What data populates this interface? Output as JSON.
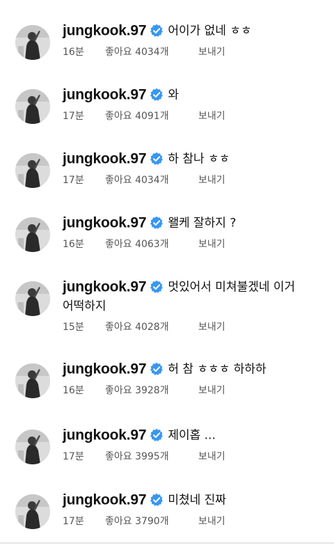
{
  "comments": [
    {
      "username": "jungkook.97",
      "text": "어이가 없네 ㅎㅎ",
      "time": "16분",
      "likes": "좋아요 4034개",
      "reply": "보내기"
    },
    {
      "username": "jungkook.97",
      "text": "와",
      "time": "17분",
      "likes": "좋아요 4091개",
      "reply": "보내기"
    },
    {
      "username": "jungkook.97",
      "text": "하 참나 ㅎㅎ",
      "time": "17분",
      "likes": "좋아요 4034개",
      "reply": "보내기"
    },
    {
      "username": "jungkook.97",
      "text": "왤케 잘하지 ?",
      "time": "16분",
      "likes": "좋아요 4063개",
      "reply": "보내기"
    },
    {
      "username": "jungkook.97",
      "text": "멋있어서 미쳐불겠네 이거",
      "text_cont": "어떡하지",
      "time": "15분",
      "likes": "좋아요 4028개",
      "reply": "보내기"
    },
    {
      "username": "jungkook.97",
      "text": "허 참 ㅎㅎㅎ 하하하",
      "time": "16분",
      "likes": "좋아요 3928개",
      "reply": "보내기"
    },
    {
      "username": "jungkook.97",
      "text": "제이홉 ...",
      "time": "17분",
      "likes": "좋아요 3995개",
      "reply": "보내기"
    },
    {
      "username": "jungkook.97",
      "text": "미쳤네 진짜",
      "time": "17분",
      "likes": "좋아요 3790개",
      "reply": "보내기"
    }
  ],
  "icons": {
    "verified": "verified-badge-icon",
    "avatar": "profile-photo"
  },
  "colors": {
    "verified_badge": "#3897f0",
    "meta_text": "#555555"
  }
}
